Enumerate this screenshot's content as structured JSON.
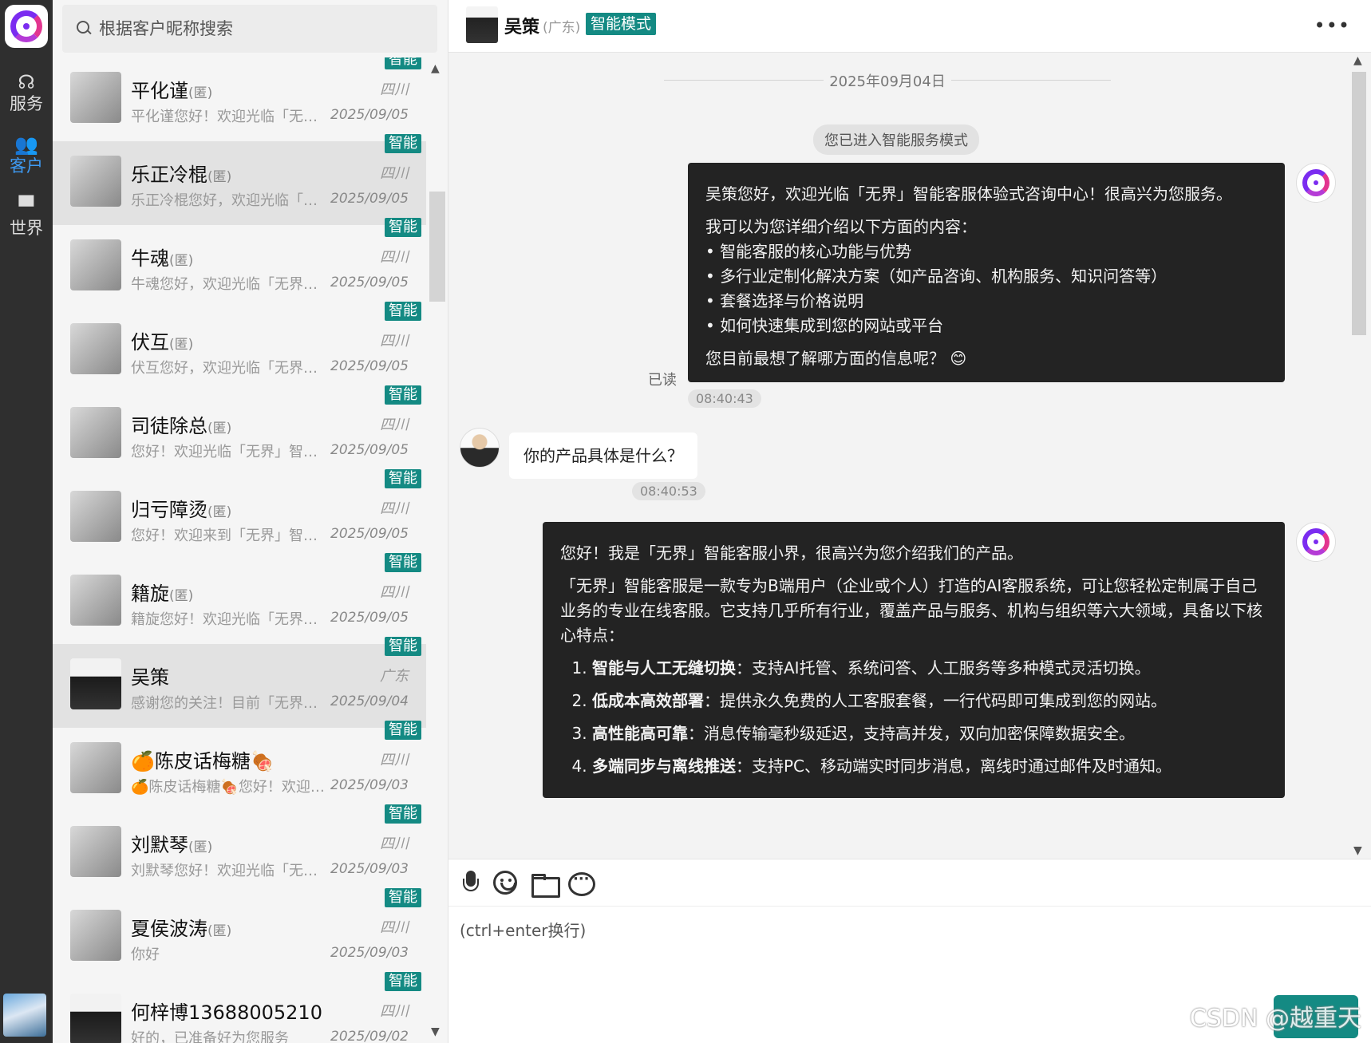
{
  "rail": {
    "items": [
      {
        "icon": "headset-icon",
        "label": "服务"
      },
      {
        "icon": "users-icon",
        "label": "客户"
      },
      {
        "icon": "chat-icon",
        "label": "世界"
      }
    ]
  },
  "search": {
    "placeholder": "根据客户昵称搜索"
  },
  "conversations": [
    {
      "name": "平化谨",
      "anon": "(匿)",
      "region": "四川",
      "preview": "平化谨您好！欢迎光临「无界」智能客服",
      "date": "2025/09/05",
      "tag": "智能"
    },
    {
      "name": "乐正冷棍",
      "anon": "(匿)",
      "region": "四川",
      "preview": "乐正冷棍您好，欢迎光临「无界」智能客服",
      "date": "2025/09/05",
      "tag": "智能"
    },
    {
      "name": "牛魂",
      "anon": "(匿)",
      "region": "四川",
      "preview": "牛魂您好，欢迎光临「无界」智能客服",
      "date": "2025/09/05",
      "tag": "智能"
    },
    {
      "name": "伏互",
      "anon": "(匿)",
      "region": "四川",
      "preview": "伏互您好，欢迎光临「无界」智能客服",
      "date": "2025/09/05",
      "tag": "智能"
    },
    {
      "name": "司徒除总",
      "anon": "(匿)",
      "region": "四川",
      "preview": "您好！欢迎光临「无界」智能客服体验",
      "date": "2025/09/05",
      "tag": "智能"
    },
    {
      "name": "归亏障烫",
      "anon": "(匿)",
      "region": "四川",
      "preview": "您好！欢迎来到「无界」智能客服体验",
      "date": "2025/09/05",
      "tag": "智能"
    },
    {
      "name": "籍旋",
      "anon": "(匿)",
      "region": "四川",
      "preview": "籍旋您好！欢迎光临「无界」智能客服",
      "date": "2025/09/05",
      "tag": "智能"
    },
    {
      "name": "吴策",
      "anon": "",
      "region": "广东",
      "preview": "感谢您的关注！目前「无界」智能客服",
      "date": "2025/09/04",
      "tag": "智能"
    },
    {
      "name": "🍊陈皮话梅糖🍖",
      "anon": "",
      "region": "四川",
      "preview": "🍊陈皮话梅糖🍖您好！欢迎光临",
      "date": "2025/09/03",
      "tag": "智能"
    },
    {
      "name": "刘默琴",
      "anon": "(匿)",
      "region": "四川",
      "preview": "刘默琴您好！欢迎光临「无界」智能客服",
      "date": "2025/09/03",
      "tag": "智能"
    },
    {
      "name": "夏侯波涛",
      "anon": "(匿)",
      "region": "四川",
      "preview": "你好",
      "date": "2025/09/03",
      "tag": "智能"
    },
    {
      "name": "何梓博13688005210",
      "anon": "",
      "region": "四川",
      "preview": "好的，已准备好为您服务",
      "date": "2025/09/02",
      "tag": "智能"
    }
  ],
  "header": {
    "name": "吴策",
    "region": "(广东)",
    "mode": "智能模式",
    "more": "•••"
  },
  "chat": {
    "date_separator": "2025年09月04日",
    "system_notice": "您已进入智能服务模式",
    "msg1": {
      "intro": "吴策您好，欢迎光临「无界」智能客服体验式咨询中心！很高兴为您服务。",
      "lead": "我可以为您详细介绍以下方面的内容：",
      "bullets": [
        "• 智能客服的核心功能与优势",
        "• 多行业定制化解决方案（如产品咨询、机构服务、知识问答等）",
        "• 套餐选择与价格说明",
        "• 如何快速集成到您的网站或平台"
      ],
      "closing": "您目前最想了解哪方面的信息呢？ 😊",
      "read": "已读",
      "time": "08:40:43"
    },
    "msg2": {
      "text": "你的产品具体是什么？",
      "time": "08:40:53"
    },
    "msg3": {
      "p1": "您好！我是「无界」智能客服小界，很高兴为您介绍我们的产品。",
      "p2": "「无界」智能客服是一款专为B端用户（企业或个人）打造的AI客服系统，可让您轻松定制属于自己业务的专业在线客服。它支持几乎所有行业，覆盖产品与服务、机构与组织等六大领域，具备以下核心特点：",
      "points": [
        {
          "title": "智能与人工无缝切换",
          "desc": "：支持AI托管、系统问答、人工服务等多种模式灵活切换。"
        },
        {
          "title": "低成本高效部署",
          "desc": "：提供永久免费的人工客服套餐，一行代码即可集成到您的网站。"
        },
        {
          "title": "高性能高可靠",
          "desc": "：消息传输毫秒级延迟，支持高并发，双向加密保障数据安全。"
        },
        {
          "title": "多端同步与离线推送",
          "desc": "：支持PC、移动端实时同步消息，离线时通过邮件及时通知。"
        }
      ]
    }
  },
  "composer": {
    "placeholder": "(ctrl+enter换行)"
  },
  "watermark": "CSDN @越重天",
  "colors": {
    "accent": "#148a83",
    "rail_active": "#3e9bf4",
    "bubble_dark": "#232323"
  }
}
